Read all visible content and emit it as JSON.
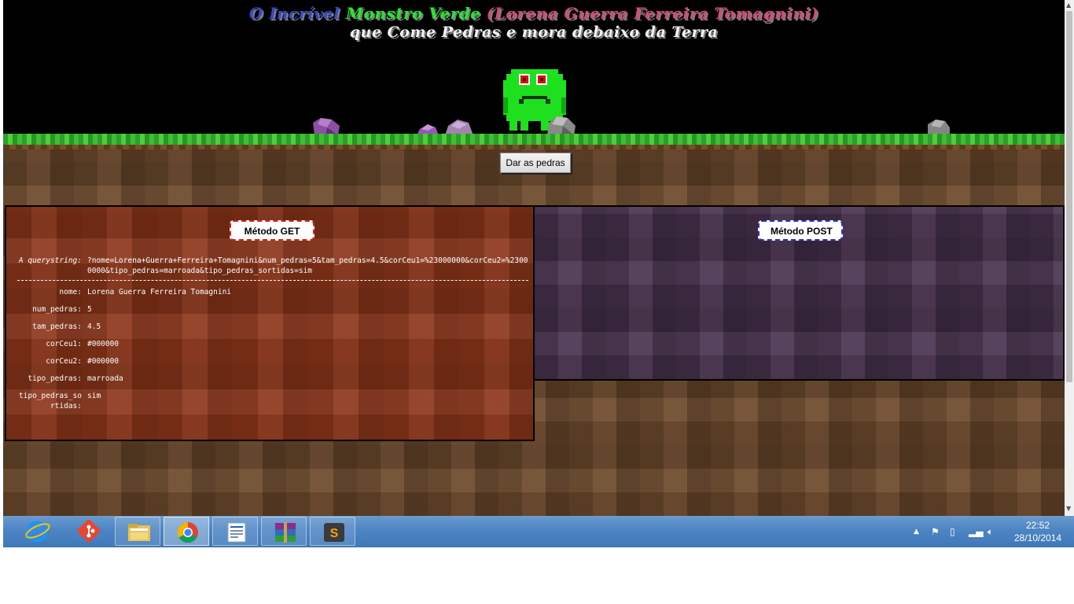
{
  "header": {
    "title_prefix": "O Incrível ",
    "title_monster": "Monstro Verde",
    "title_name": " (Lorena Guerra Ferreira Tomagnini)",
    "subtitle": "que Come Pedras e mora debaixo da Terra"
  },
  "action_button": {
    "label": "Dar as pedras"
  },
  "get_panel": {
    "label": "Método GET",
    "querystring_key": "A querystring:",
    "querystring_value": "?nome=Lorena+Guerra+Ferreira+Tomagnini&num_pedras=5&tam_pedras=4.5&corCeu1=%23000000&corCeu2=%23000000&tipo_pedras=marroada&tipo_pedras_sortidas=sim",
    "fields": [
      {
        "key": "nome:",
        "value": "Lorena Guerra Ferreira Tomagnini"
      },
      {
        "key": "num_pedras:",
        "value": "5"
      },
      {
        "key": "tam_pedras:",
        "value": "4.5"
      },
      {
        "key": "corCeu1:",
        "value": "#000000"
      },
      {
        "key": "corCeu2:",
        "value": "#000000"
      },
      {
        "key": "tipo_pedras:",
        "value": "marroada"
      },
      {
        "key": "tipo_pedras_sortidas:",
        "value": "sim"
      }
    ]
  },
  "post_panel": {
    "label": "Método POST"
  },
  "taskbar": {
    "apps": [
      "internet-explorer-icon",
      "git-icon",
      "file-explorer-icon",
      "chrome-icon",
      "wordpad-icon",
      "winrar-icon",
      "sublime-text-icon"
    ],
    "active_app": "chrome-icon",
    "clock_time": "22:52",
    "clock_date": "28/10/2014"
  },
  "colors": {
    "title_prefix": "#3a49c7",
    "title_monster": "#22e82e",
    "title_name": "#d34a78",
    "monster": "#1fe01f",
    "get_panel": "#8c3519",
    "post_panel": "#4a3350",
    "get_label_border": "#d42020",
    "post_label_border": "#2530c4",
    "taskbar": "#4f86c4"
  }
}
